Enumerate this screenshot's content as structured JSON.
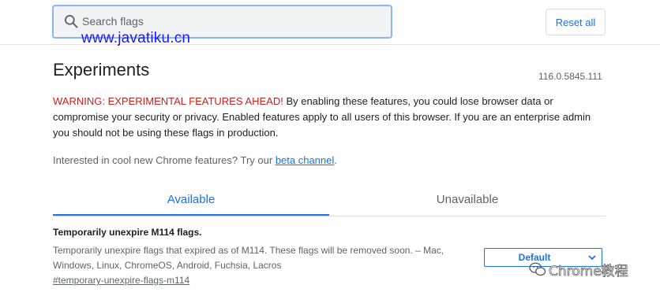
{
  "header": {
    "search_placeholder": "Search flags",
    "reset_label": "Reset all",
    "watermark_url": "www.javatiku.cn"
  },
  "page": {
    "title": "Experiments",
    "version": "116.0.5845.111"
  },
  "warning": {
    "label": "WARNING: EXPERIMENTAL FEATURES AHEAD!",
    "text": " By enabling these features, you could lose browser data or compromise your security or privacy. Enabled features apply to all users of this browser. If you are an enterprise admin you should not be using these flags in production."
  },
  "promo": {
    "text": "Interested in cool new Chrome features? Try our ",
    "link_label": "beta channel",
    "suffix": "."
  },
  "tabs": [
    {
      "label": "Available",
      "selected": true
    },
    {
      "label": "Unavailable",
      "selected": false
    }
  ],
  "flags": [
    {
      "title": "Temporarily unexpire M114 flags.",
      "description": "Temporarily unexpire flags that expired as of M114. These flags will be removed soon. – Mac, Windows, Linux, ChromeOS, Android, Fuchsia, Lacros",
      "anchor": "#temporary-unexpire-flags-m114",
      "selected_value": "Default"
    }
  ],
  "watermark": {
    "text": "Chrome教程"
  },
  "colors": {
    "accent": "#1a73e8",
    "warning": "#c5221f",
    "search_border": "#8ab4f8",
    "watermark_url": "#1a1aff"
  }
}
